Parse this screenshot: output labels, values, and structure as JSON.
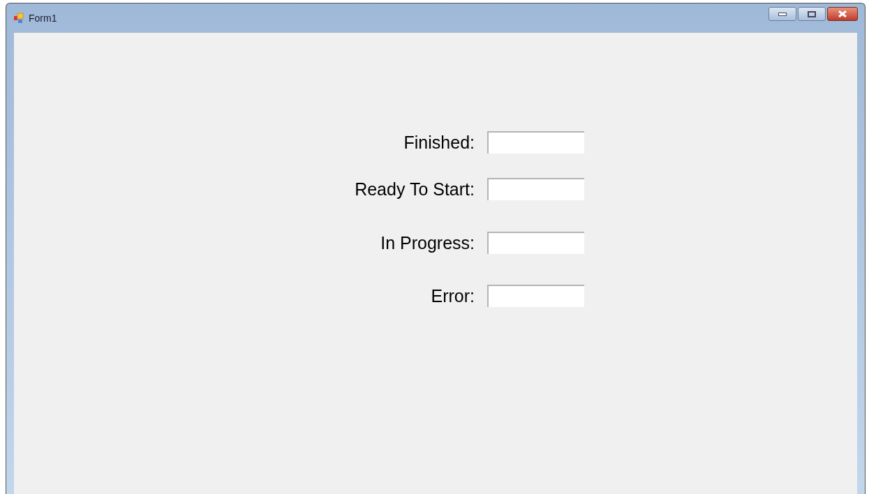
{
  "window": {
    "title": "Form1"
  },
  "fields": [
    {
      "label": "Finished:"
    },
    {
      "label": "Ready To Start:"
    },
    {
      "label": "In Progress:"
    },
    {
      "label": "Error:"
    }
  ]
}
